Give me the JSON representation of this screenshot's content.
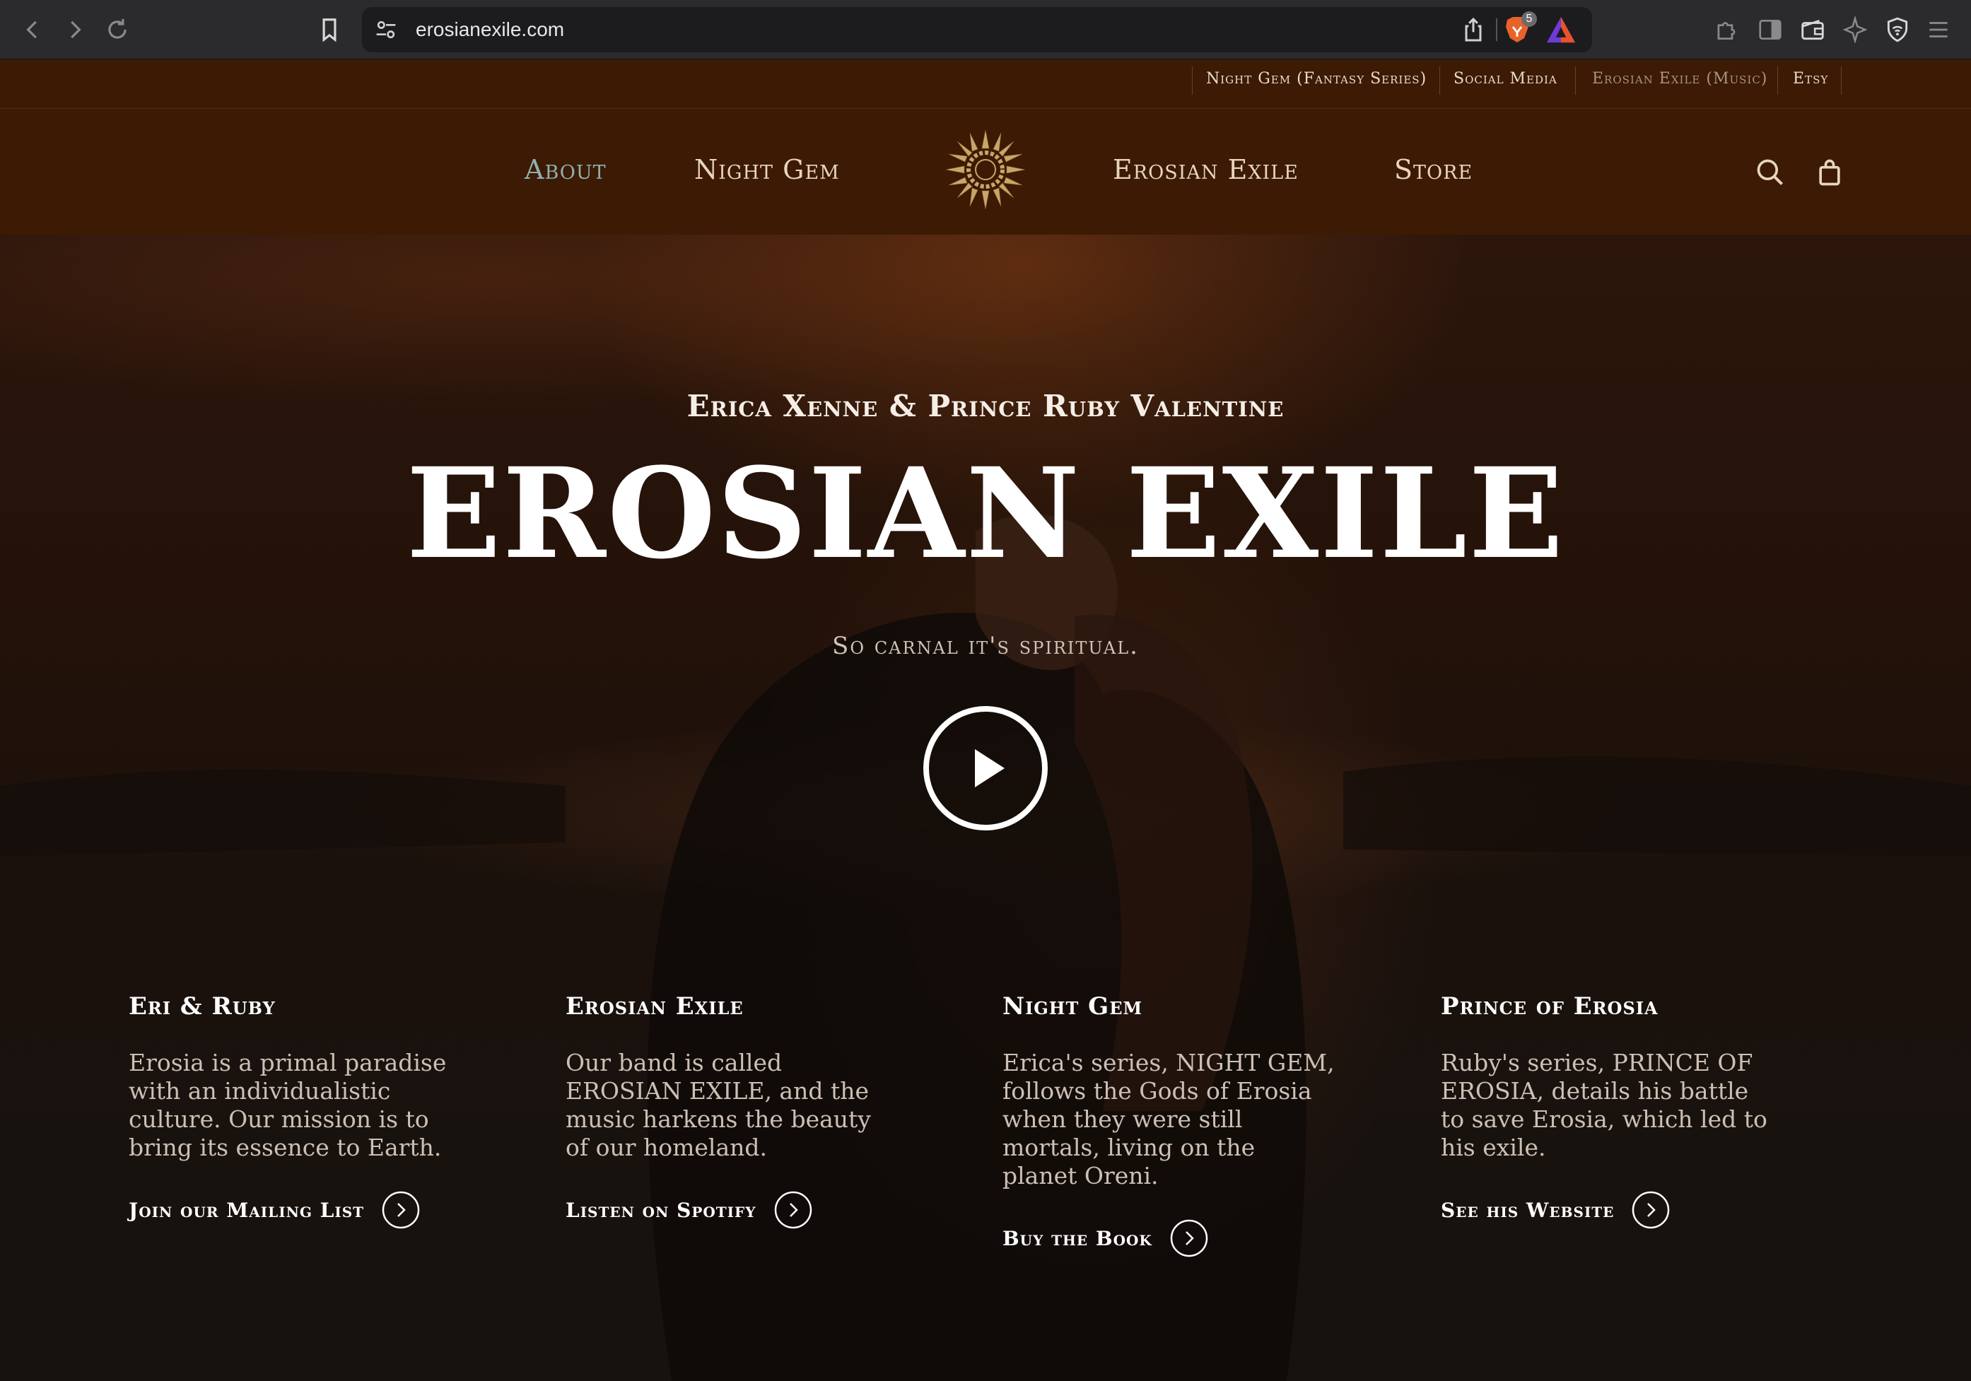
{
  "browser": {
    "url": "erosianexile.com",
    "shield_badge": "5"
  },
  "topbar": {
    "links": [
      {
        "label": "Night Gem (Fantasy Series)"
      },
      {
        "label": "Social Media"
      },
      {
        "label": "Erosian Exile (Music)"
      },
      {
        "label": "Etsy"
      }
    ]
  },
  "nav": {
    "about": "About",
    "night_gem": "Night Gem",
    "erosian_exile": "Erosian Exile",
    "store": "Store",
    "icons": [
      "search-icon",
      "shopping-bag-icon",
      "sun-logo"
    ]
  },
  "hero": {
    "subtitle": "Erica Xenne & Prince Ruby Valentine",
    "title": "EROSIAN EXILE",
    "tagline": "So carnal it's spiritual."
  },
  "columns": [
    {
      "heading": "Eri & Ruby",
      "body": "Erosia is a primal paradise with an individualistic culture. Our mission is to bring its essence to Earth.",
      "cta": "Join our Mailing List"
    },
    {
      "heading": "Erosian Exile",
      "body": "Our band is called EROSIAN EXILE, and the music harkens the beauty of our homeland.",
      "cta": "Listen on Spotify"
    },
    {
      "heading": "Night Gem",
      "body": "Erica's series, NIGHT GEM, follows the Gods of Erosia when they were still mortals, living on the planet Oreni.",
      "cta": "Buy the Book"
    },
    {
      "heading": "Prince of Erosia",
      "body": "Ruby's series, PRINCE OF EROSIA, details his battle to save Erosia, which led to his exile.",
      "cta": "See his Website"
    }
  ],
  "colors": {
    "header_bg": "#3c1a03",
    "nav_text": "#e7d5bd",
    "nav_active": "#8fb0b0",
    "logo_gold": "#c9a56a"
  }
}
